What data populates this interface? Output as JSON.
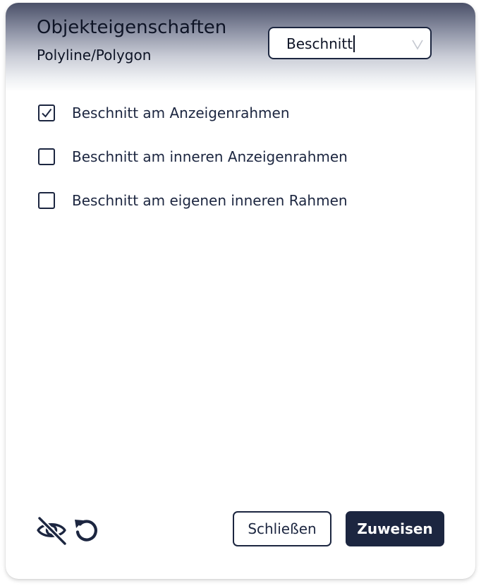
{
  "header": {
    "title": "Objekteigenschaften",
    "subtitle": "Polyline/Polygon"
  },
  "category_select": {
    "value": "Beschnitt",
    "icon": "chevron-down-icon"
  },
  "options": [
    {
      "label": "Beschnitt am Anzeigenrahmen",
      "checked": true
    },
    {
      "label": "Beschnitt am inneren Anzeigenrahmen",
      "checked": false
    },
    {
      "label": "Beschnitt am eigenen inneren Rahmen",
      "checked": false
    }
  ],
  "footer": {
    "visibility_icon": "eye-off-icon",
    "reset_icon": "undo-icon",
    "close_label": "Schließen",
    "apply_label": "Zuweisen"
  },
  "colors": {
    "primary": "#1c2640",
    "header_dark": "#4a5068"
  }
}
